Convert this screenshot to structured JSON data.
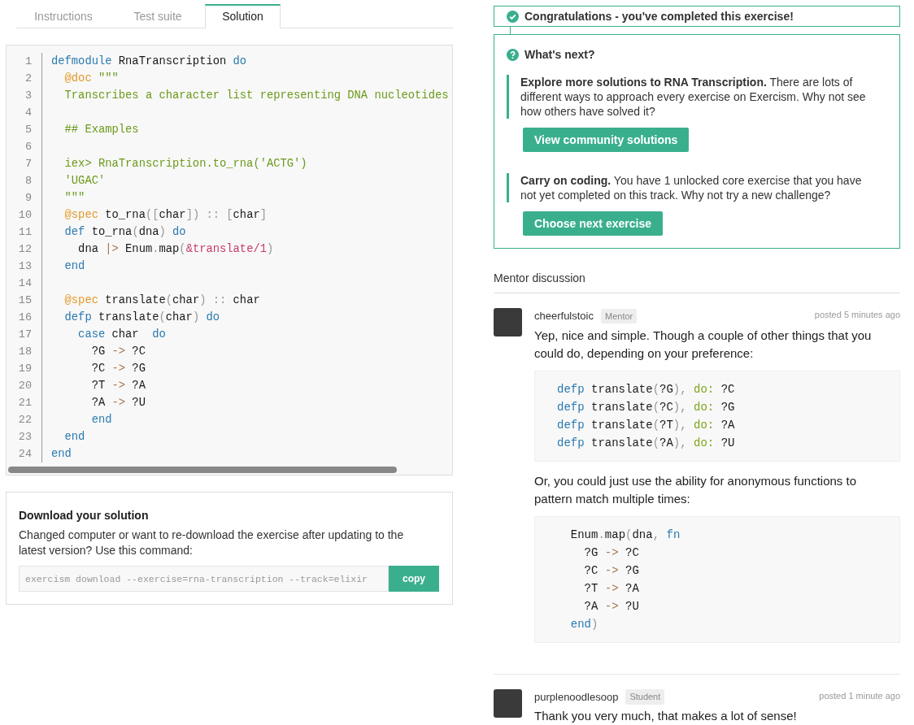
{
  "tabs": [
    {
      "label": "Instructions",
      "selected": false
    },
    {
      "label": "Test suite",
      "selected": false
    },
    {
      "label": "Solution",
      "selected": true
    }
  ],
  "solution_code": {
    "lines": [
      {
        "number": "1",
        "tokens": [
          {
            "kind": "kw",
            "text": "defmodule"
          },
          {
            "kind": "plain",
            "text": " RnaTranscription "
          },
          {
            "kind": "kw",
            "text": "do"
          }
        ]
      },
      {
        "number": "2",
        "tokens": [
          {
            "kind": "attr",
            "text": "  @doc"
          },
          {
            "kind": "str",
            "text": " \"\"\""
          }
        ]
      },
      {
        "number": "3",
        "tokens": [
          {
            "kind": "str",
            "text": "  Transcribes a character list representing DNA nucleotides"
          }
        ]
      },
      {
        "number": "4"
      },
      {
        "number": "5",
        "tokens": [
          {
            "kind": "str",
            "text": "  ## Examples"
          }
        ]
      },
      {
        "number": "6"
      },
      {
        "number": "7",
        "tokens": [
          {
            "kind": "str",
            "text": "  iex> RnaTranscription.to_rna('ACTG')"
          }
        ]
      },
      {
        "number": "8",
        "tokens": [
          {
            "kind": "str",
            "text": "  'UGAC'"
          }
        ]
      },
      {
        "number": "9",
        "tokens": [
          {
            "kind": "str",
            "text": "  \"\"\""
          }
        ]
      },
      {
        "number": "10",
        "tokens": [
          {
            "kind": "attr",
            "text": "  @spec"
          },
          {
            "kind": "plain",
            "text": " to_rna"
          },
          {
            "kind": "punct",
            "text": "(["
          },
          {
            "kind": "plain",
            "text": "char"
          },
          {
            "kind": "punct",
            "text": "]) :: ["
          },
          {
            "kind": "plain",
            "text": "char"
          },
          {
            "kind": "punct",
            "text": "]"
          }
        ]
      },
      {
        "number": "11",
        "tokens": [
          {
            "kind": "kw",
            "text": "  def"
          },
          {
            "kind": "plain",
            "text": " to_rna"
          },
          {
            "kind": "punct",
            "text": "("
          },
          {
            "kind": "plain",
            "text": "dna"
          },
          {
            "kind": "punct",
            "text": ")"
          },
          {
            "kind": "kw",
            "text": " do"
          }
        ]
      },
      {
        "number": "12",
        "tokens": [
          {
            "kind": "plain",
            "text": "    dna "
          },
          {
            "kind": "op",
            "text": "|>"
          },
          {
            "kind": "plain",
            "text": " Enum"
          },
          {
            "kind": "punct",
            "text": "."
          },
          {
            "kind": "plain",
            "text": "map"
          },
          {
            "kind": "punct",
            "text": "("
          },
          {
            "kind": "ref",
            "text": "&translate/1"
          },
          {
            "kind": "punct",
            "text": ")"
          }
        ]
      },
      {
        "number": "13",
        "tokens": [
          {
            "kind": "kw",
            "text": "  end"
          }
        ]
      },
      {
        "number": "14"
      },
      {
        "number": "15",
        "tokens": [
          {
            "kind": "attr",
            "text": "  @spec"
          },
          {
            "kind": "plain",
            "text": " translate"
          },
          {
            "kind": "punct",
            "text": "("
          },
          {
            "kind": "plain",
            "text": "char"
          },
          {
            "kind": "punct",
            "text": ") :: "
          },
          {
            "kind": "plain",
            "text": "char"
          }
        ]
      },
      {
        "number": "16",
        "tokens": [
          {
            "kind": "kw",
            "text": "  defp"
          },
          {
            "kind": "plain",
            "text": " translate"
          },
          {
            "kind": "punct",
            "text": "("
          },
          {
            "kind": "plain",
            "text": "char"
          },
          {
            "kind": "punct",
            "text": ")"
          },
          {
            "kind": "kw",
            "text": " do"
          }
        ]
      },
      {
        "number": "17",
        "tokens": [
          {
            "kind": "kw",
            "text": "    case"
          },
          {
            "kind": "plain",
            "text": " char"
          },
          {
            "kind": "kw",
            "text": "  do"
          }
        ]
      },
      {
        "number": "18",
        "tokens": [
          {
            "kind": "plain",
            "text": "      ?G "
          },
          {
            "kind": "op",
            "text": "->"
          },
          {
            "kind": "plain",
            "text": " ?C"
          }
        ]
      },
      {
        "number": "19",
        "tokens": [
          {
            "kind": "plain",
            "text": "      ?C "
          },
          {
            "kind": "op",
            "text": "->"
          },
          {
            "kind": "plain",
            "text": " ?G"
          }
        ]
      },
      {
        "number": "20",
        "tokens": [
          {
            "kind": "plain",
            "text": "      ?T "
          },
          {
            "kind": "op",
            "text": "->"
          },
          {
            "kind": "plain",
            "text": " ?A"
          }
        ]
      },
      {
        "number": "21",
        "tokens": [
          {
            "kind": "plain",
            "text": "      ?A "
          },
          {
            "kind": "op",
            "text": "->"
          },
          {
            "kind": "plain",
            "text": " ?U"
          }
        ]
      },
      {
        "number": "22",
        "tokens": [
          {
            "kind": "kw",
            "text": "      end"
          }
        ]
      },
      {
        "number": "23",
        "tokens": [
          {
            "kind": "kw",
            "text": "  end"
          }
        ]
      },
      {
        "number": "24",
        "tokens": [
          {
            "kind": "kw",
            "text": "end"
          }
        ]
      }
    ]
  },
  "download": {
    "title": "Download your solution",
    "text": "Changed computer or want to re-download the exercise after updating to the latest version? Use this command:",
    "command": "exercism download --exercise=rna-transcription --track=elixir",
    "button": "copy"
  },
  "completed_banner": {
    "text": "Congratulations - you've completed this exercise!"
  },
  "whats_next": {
    "title": "What's next?",
    "items": [
      {
        "text": "**Explore more solutions to RNA Transcription.** There are lots of different ways to approach every exercise on Exercism. Why not see how others have solved it?",
        "button": "View community solutions"
      },
      {
        "text": "**Carry on coding.** You have 1 unlocked core exercise that you have not yet completed on this track. Why not try a new challenge?",
        "button": "Choose next exercise"
      }
    ]
  },
  "mentor_discussion": {
    "title": "Mentor discussion",
    "comments": [
      {
        "author": "cheerfulstoic",
        "role": "Mentor",
        "time": "posted 5 minutes ago",
        "body": [
          {
            "kind": "text",
            "text": "Yep, nice and simple. Though a couple of other things that you could do, depending on your preference:"
          },
          {
            "kind": "code",
            "lines": [
              [
                {
                  "kind": "kw",
                  "text": "defp"
                },
                {
                  "kind": "plain",
                  "text": " translate"
                },
                {
                  "kind": "punct",
                  "text": "("
                },
                {
                  "kind": "plain",
                  "text": "?G"
                },
                {
                  "kind": "punct",
                  "text": "),"
                },
                {
                  "kind": "atom",
                  "text": " do:"
                },
                {
                  "kind": "plain",
                  "text": " ?C"
                }
              ],
              [
                {
                  "kind": "kw",
                  "text": "defp"
                },
                {
                  "kind": "plain",
                  "text": " translate"
                },
                {
                  "kind": "punct",
                  "text": "("
                },
                {
                  "kind": "plain",
                  "text": "?C"
                },
                {
                  "kind": "punct",
                  "text": "),"
                },
                {
                  "kind": "atom",
                  "text": " do:"
                },
                {
                  "kind": "plain",
                  "text": " ?G"
                }
              ],
              [
                {
                  "kind": "kw",
                  "text": "defp"
                },
                {
                  "kind": "plain",
                  "text": " translate"
                },
                {
                  "kind": "punct",
                  "text": "("
                },
                {
                  "kind": "plain",
                  "text": "?T"
                },
                {
                  "kind": "punct",
                  "text": "),"
                },
                {
                  "kind": "atom",
                  "text": " do:"
                },
                {
                  "kind": "plain",
                  "text": " ?A"
                }
              ],
              [
                {
                  "kind": "kw",
                  "text": "defp"
                },
                {
                  "kind": "plain",
                  "text": " translate"
                },
                {
                  "kind": "punct",
                  "text": "("
                },
                {
                  "kind": "plain",
                  "text": "?A"
                },
                {
                  "kind": "punct",
                  "text": "),"
                },
                {
                  "kind": "atom",
                  "text": " do:"
                },
                {
                  "kind": "plain",
                  "text": " ?U"
                }
              ]
            ]
          },
          {
            "kind": "text",
            "text": "Or, you could just use the ability for anonymous functions to pattern match multiple times:"
          },
          {
            "kind": "code",
            "lines": [
              [
                {
                  "kind": "plain",
                  "text": "  Enum"
                },
                {
                  "kind": "punct",
                  "text": "."
                },
                {
                  "kind": "plain",
                  "text": "map"
                },
                {
                  "kind": "punct",
                  "text": "("
                },
                {
                  "kind": "plain",
                  "text": "dna"
                },
                {
                  "kind": "punct",
                  "text": ","
                },
                {
                  "kind": "kw",
                  "text": " fn"
                }
              ],
              [
                {
                  "kind": "plain",
                  "text": "    ?G "
                },
                {
                  "kind": "op",
                  "text": "->"
                },
                {
                  "kind": "plain",
                  "text": " ?C"
                }
              ],
              [
                {
                  "kind": "plain",
                  "text": "    ?C "
                },
                {
                  "kind": "op",
                  "text": "->"
                },
                {
                  "kind": "plain",
                  "text": " ?G"
                }
              ],
              [
                {
                  "kind": "plain",
                  "text": "    ?T "
                },
                {
                  "kind": "op",
                  "text": "->"
                },
                {
                  "kind": "plain",
                  "text": " ?A"
                }
              ],
              [
                {
                  "kind": "plain",
                  "text": "    ?A "
                },
                {
                  "kind": "op",
                  "text": "->"
                },
                {
                  "kind": "plain",
                  "text": " ?U"
                }
              ],
              [
                {
                  "kind": "kw",
                  "text": "  end"
                },
                {
                  "kind": "punct",
                  "text": ")"
                }
              ]
            ]
          }
        ]
      },
      {
        "author": "purplenoodlesoop",
        "role": "Student",
        "time": "posted 1 minute ago",
        "body": [
          {
            "kind": "text",
            "text": "Thank you very much, that makes a lot of sense!"
          }
        ]
      }
    ]
  }
}
